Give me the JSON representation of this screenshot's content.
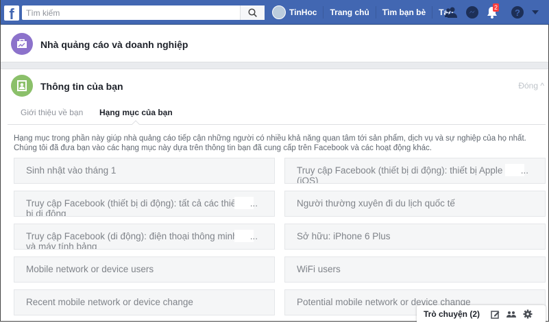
{
  "topbar": {
    "logo": "f",
    "search_placeholder": "Tìm kiếm",
    "user": "TinHoc",
    "links": [
      "Trang chủ",
      "Tìm bạn bè",
      "Tạo"
    ],
    "notification_count": "2"
  },
  "section1": {
    "title": "Nhà quảng cáo và doanh nghiệp"
  },
  "section2": {
    "title": "Thông tin của bạn",
    "close_label": "Đóng",
    "tabs": [
      {
        "label": "Giới thiệu về bạn",
        "active": false
      },
      {
        "label": "Hạng mục của bạn",
        "active": true
      }
    ],
    "description": "Hạng mục trong phần này giúp nhà quảng cáo tiếp cận những người có nhiều khả năng quan tâm tới sản phẩm, dịch vụ và sự nghiệp của họ nhất. Chúng tôi đã đưa bạn vào các hạng mục này dựa trên thông tin bạn đã cung cấp trên Facebook và các hoạt động khác.",
    "categories": [
      "Sinh nhật vào tháng 1",
      "Truy cập Facebook (thiết bị di động): thiết bị Apple (iOS)",
      "Truy cập Facebook (thiết bị di động): tất cả các thiết bị di động",
      "Người thường xuyên đi du lịch quốc tế",
      "Truy cập Facebook (di động): điện thoại thông minh và máy tính bảng",
      "Sở hữu: iPhone 6 Plus",
      "Mobile network or device users",
      "WiFi users",
      "Recent mobile network or device change",
      "Potential mobile network or device change"
    ],
    "truncation": "..."
  },
  "chat": {
    "label": "Trò chuyện (2)"
  }
}
